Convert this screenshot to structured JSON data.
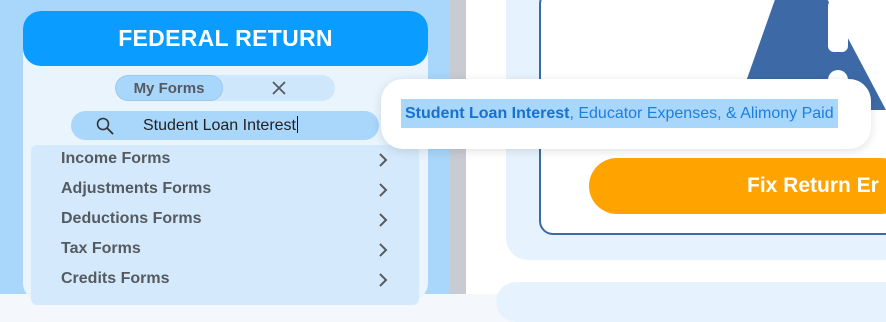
{
  "panel": {
    "title": "FEDERAL RETURN",
    "tabs": {
      "my_forms_label": "My Forms",
      "close_icon": "close-icon"
    },
    "search": {
      "value": "Student Loan Interest",
      "icon": "search-icon"
    },
    "items": [
      {
        "label": "Income Forms"
      },
      {
        "label": "Adjustments Forms"
      },
      {
        "label": "Deductions Forms"
      },
      {
        "label": "Tax Forms"
      },
      {
        "label": "Credits Forms"
      }
    ]
  },
  "autocomplete": {
    "match": "Student Loan Interest",
    "rest": ", Educator Expenses, & Alimony Paid"
  },
  "main": {
    "fix_button_label": "Fix Return Er",
    "warning_icon": "warning-icon"
  },
  "colors": {
    "header_blue": "#0a9cff",
    "accent_orange": "#ffa300",
    "highlight_blue": "#a9d6fb",
    "warning_blue": "#3d6aa6"
  }
}
